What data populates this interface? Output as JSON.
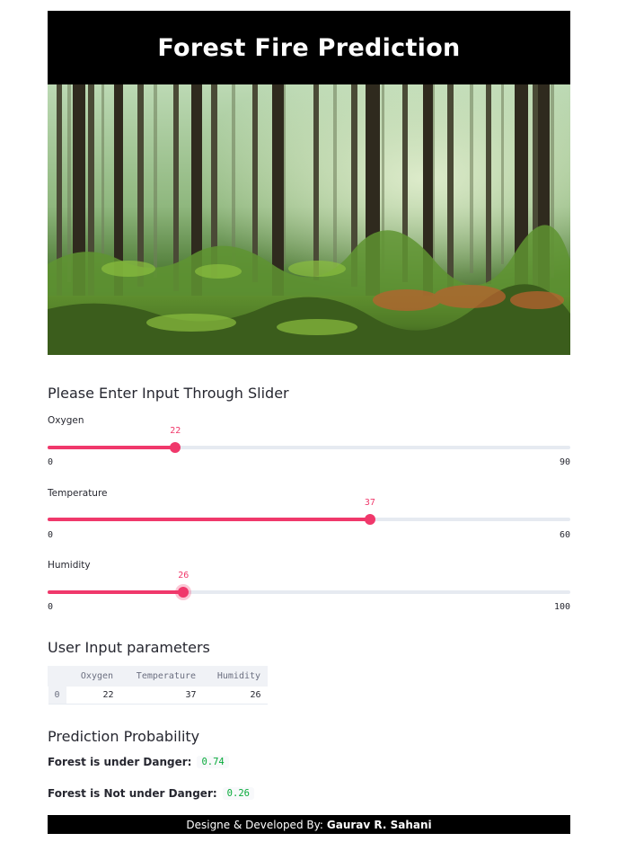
{
  "app": {
    "title": "Forest Fire Prediction"
  },
  "input_section": {
    "heading": "Please Enter Input Through Slider",
    "sliders": [
      {
        "label": "Oxygen",
        "value": 22,
        "min": 0,
        "max": 90,
        "min_label": "0",
        "max_label": "90",
        "value_label": "22"
      },
      {
        "label": "Temperature",
        "value": 37,
        "min": 0,
        "max": 60,
        "min_label": "0",
        "max_label": "60",
        "value_label": "37"
      },
      {
        "label": "Humidity",
        "value": 26,
        "min": 0,
        "max": 100,
        "min_label": "0",
        "max_label": "100",
        "value_label": "26"
      }
    ]
  },
  "params_section": {
    "heading": "User Input parameters",
    "table": {
      "columns": [
        "Oxygen",
        "Temperature",
        "Humidity"
      ],
      "rows": [
        {
          "index": "0",
          "cells": [
            "22",
            "37",
            "26"
          ]
        }
      ]
    }
  },
  "prediction_section": {
    "heading": "Prediction Probability",
    "danger_label": "Forest is under Danger:",
    "danger_value": "0.74",
    "safe_label": "Forest is Not under Danger:",
    "safe_value": "0.26"
  },
  "footer": {
    "prefix": "Designe & Developed By:",
    "author": "Gaurav R. Sahani"
  },
  "colors": {
    "accent": "#f0386b",
    "track": "#e6eaf1",
    "code_green": "#09ab3b",
    "header_bg": "#000000"
  }
}
